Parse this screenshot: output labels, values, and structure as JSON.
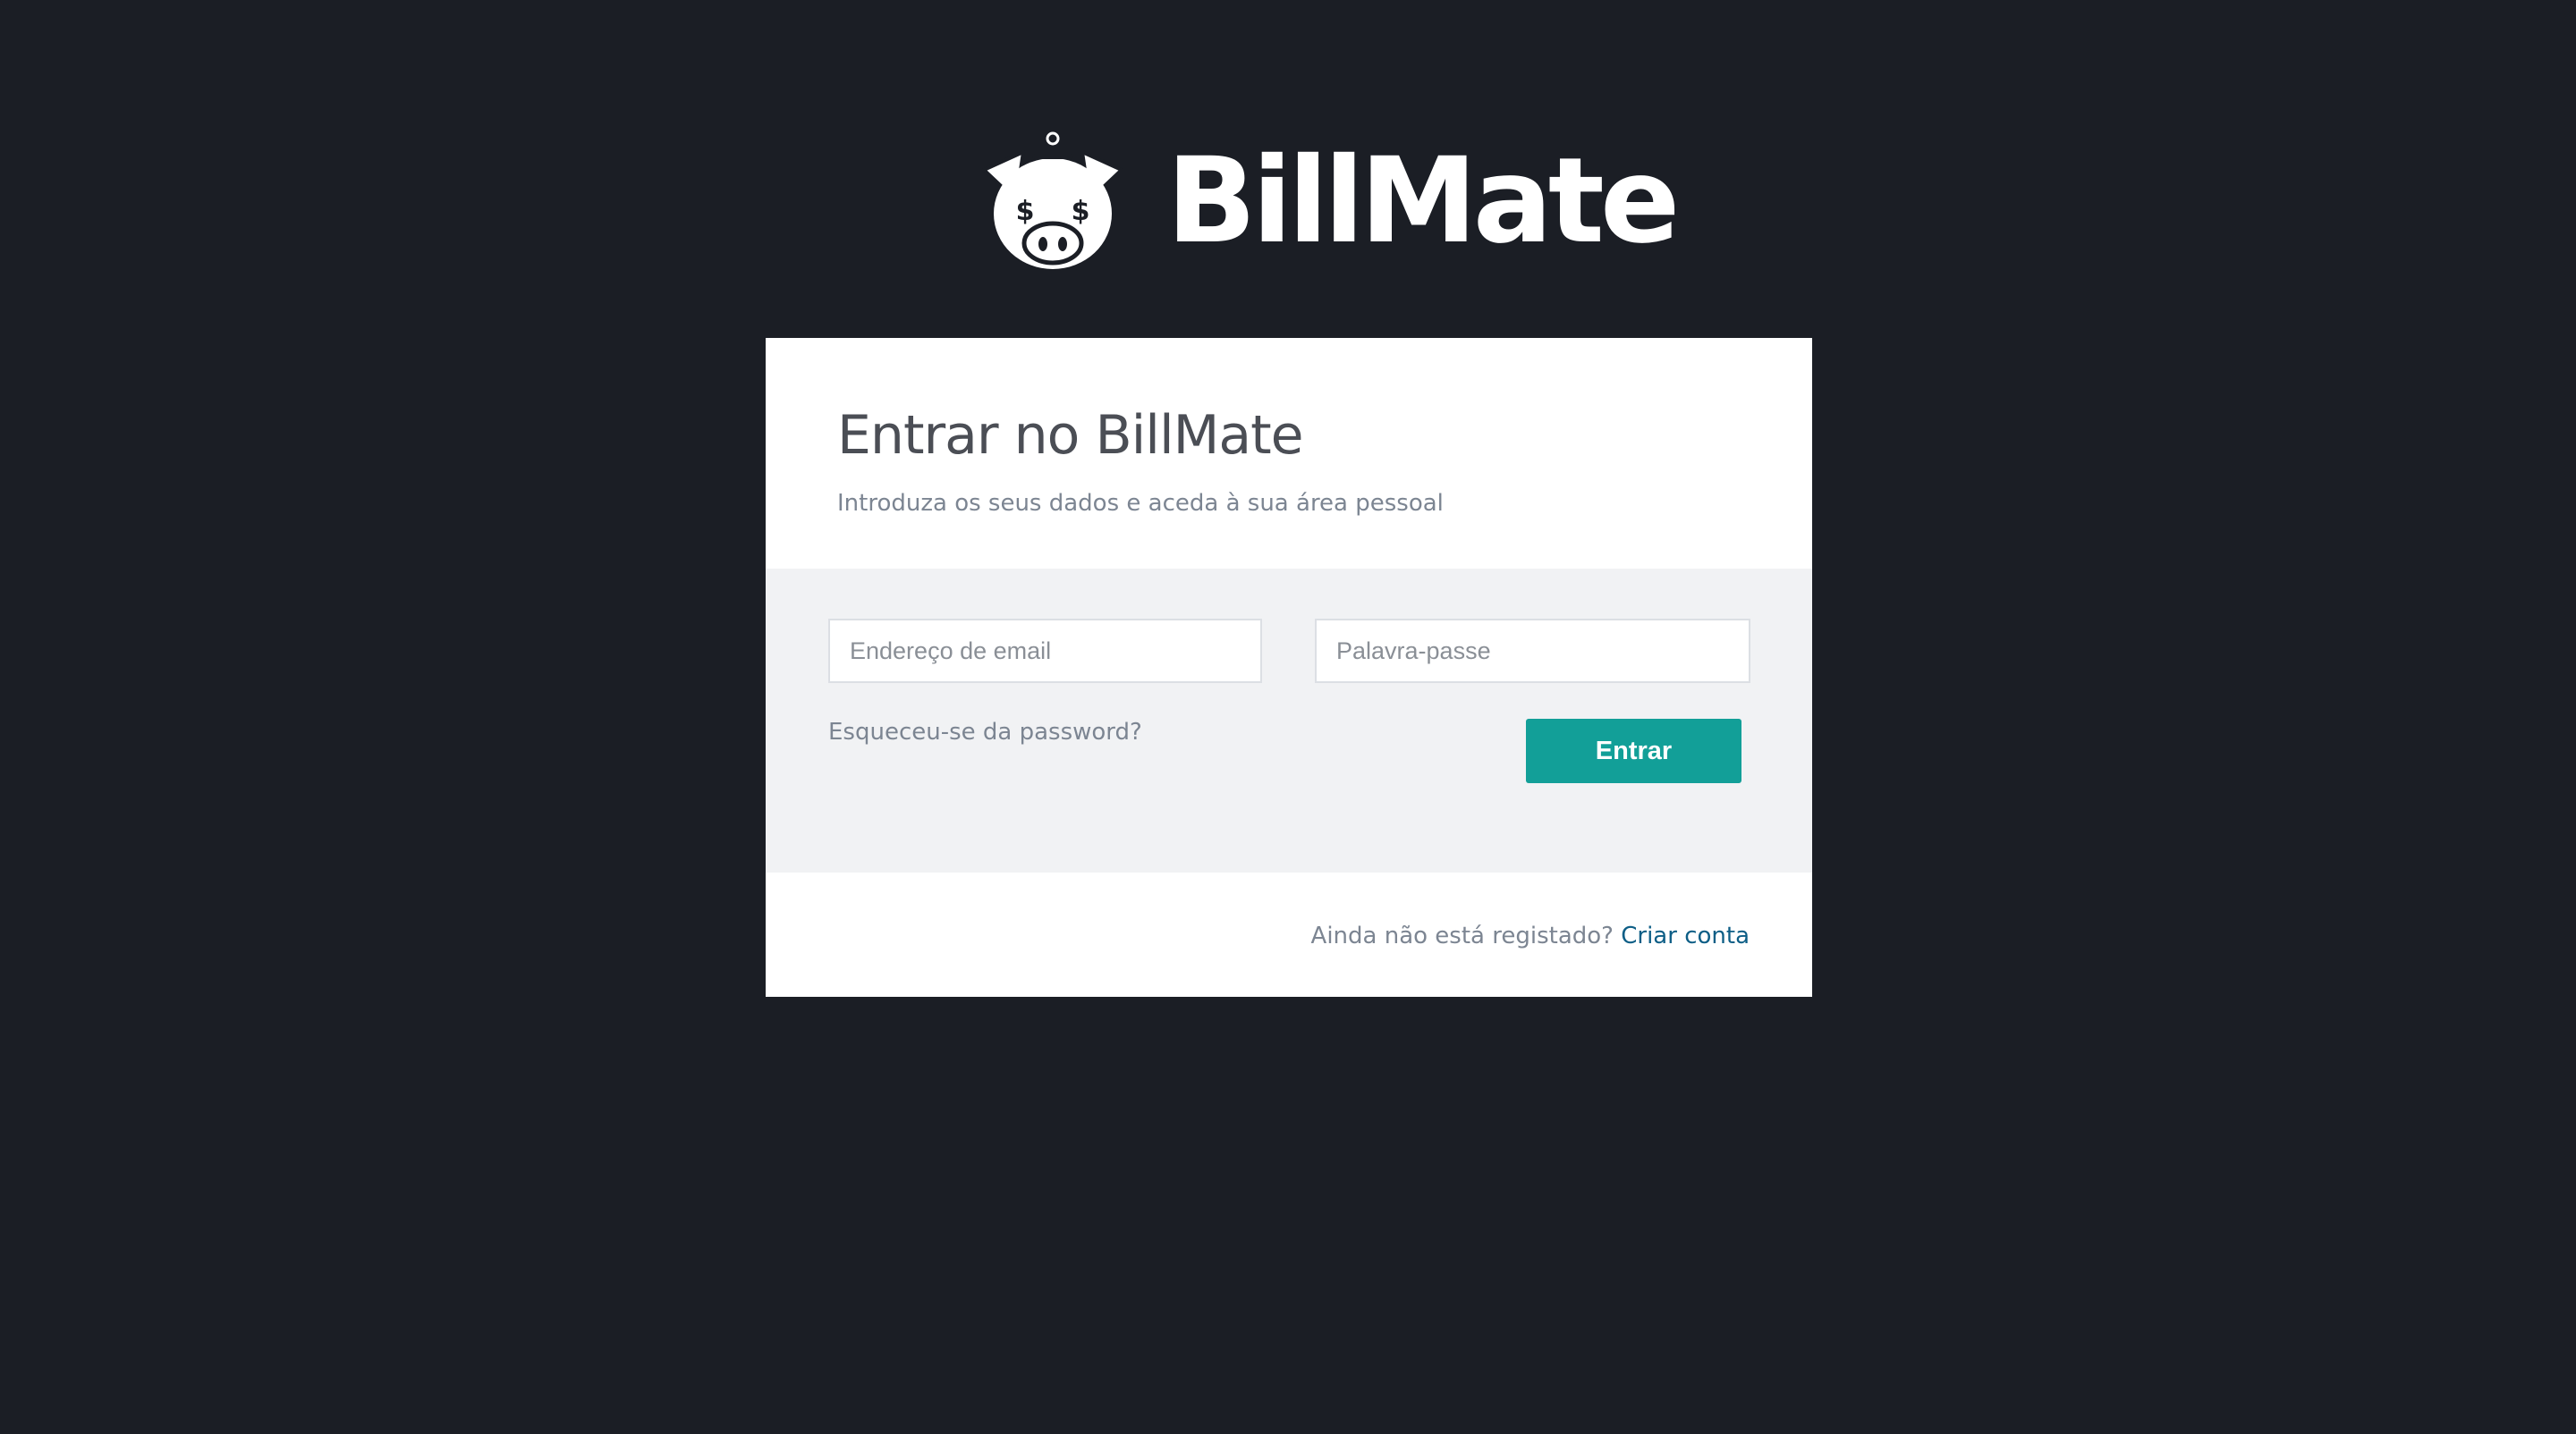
{
  "brand": {
    "logo_icon": "piggy-bank-dollar-eyes-icon",
    "name": "BillMate"
  },
  "login": {
    "title": "Entrar no BillMate",
    "subtitle": "Introduza os seus dados e aceda à sua área pessoal",
    "email_placeholder": "Endereço de email",
    "password_placeholder": "Palavra-passe",
    "forgot_link": "Esqueceu-se da password?",
    "submit_label": "Entrar"
  },
  "footer": {
    "prompt": "Ainda não está registado?",
    "signup_link": "Criar conta"
  },
  "colors": {
    "background": "#1b1e25",
    "accent": "#129f98",
    "link": "#0d5e86",
    "panel": "#f1f2f4"
  }
}
